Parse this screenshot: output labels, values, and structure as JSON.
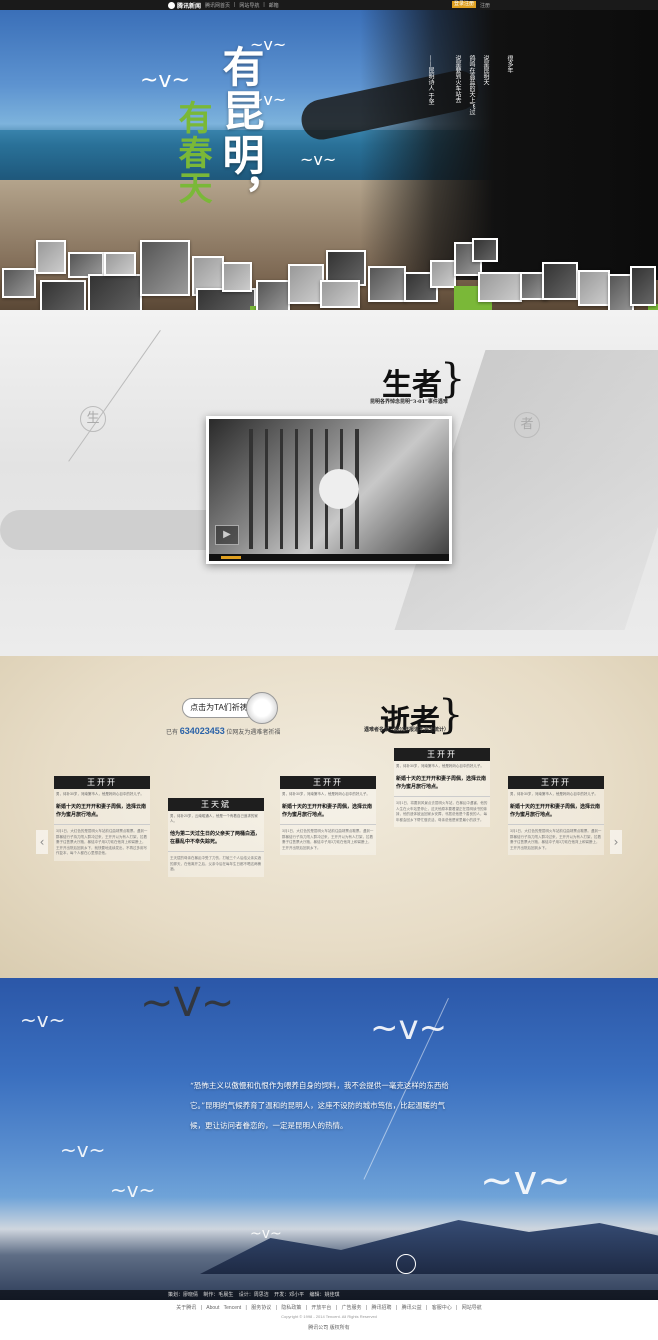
{
  "topbar": {
    "logo": "腾讯新闻",
    "nav": [
      "腾讯网首页",
      "|",
      "网站导航",
      "|",
      "邮箱"
    ],
    "login": "登录注册",
    "register": "注册"
  },
  "hero": {
    "title_main": "有昆明，",
    "title_sub": "有春天",
    "poem": [
      "说是要到火车站去",
      "说是昆明天",
      "鸽鸣在高蓝的天上飞过",
      "很多年"
    ],
    "poem_attr": "——昆明诗人 于坚"
  },
  "living": {
    "title": "生者",
    "subtitle": "昆明各界悼念昆明“3·01”事件遇难",
    "left_char": "生",
    "right_char": "者",
    "video": {
      "play_icon": "play-icon"
    }
  },
  "lost": {
    "title": "逝者",
    "subtitle": "遇难者名单（据公开报道不完全统计）",
    "pray_button": "点击为TA们祈祷",
    "count_prefix": "已有",
    "count_value": "634023453",
    "count_suffix": "位网友为遇难者祈福",
    "cards": [
      {
        "name": "王开开",
        "info": "男，待补30岁，河南第市人，他是妈妈心目中的好儿子。",
        "headline": "新婚十天的王开开和妻子周佩，选择云南作为蜜月旅行地点。",
        "body": "3月1日，大红色的是昆明火车站前往曲靖票点歇票。遇到一群暴徒行子持刀闯入群冲过来，王开开以为有人打架，拉着妻子往售票大厅跑，暴徒冲子用3刀砍在他背上和臂膀上，王开开出院后回到乡下，就快要地连续发出，不再过多用写作复本，每个人都在心里想念他。"
      },
      {
        "name": "王天斌",
        "info": "男，待补20岁，云南昭通人，他是一个有着自己追求的家人。",
        "headline": "他为第二天过生日的父亲买了两桶白酒，在暴乱中不幸失踪死。",
        "body": "王天斌的母亲在暴乱中受了刀伤，打破三个人后给父亲买酒的那天，在他离开之后，父亲今后在每年生日都不喝这两桶酒。"
      },
      {
        "name": "王开开",
        "info": "男，待补30岁，河南第市人，他是妈妈心目中的好儿子。",
        "headline": "新婚十天的王开开和妻子周佩，选择云南作为蜜月旅行地点。",
        "body": "3月1日，大红色的是昆明火车站前往曲靖票点歇票。遇到一群暴徒行子持刀闯入群冲过来，王开开以为有人打架，拉着妻子往售票大厅跑，暴徒冲子用3刀砍在他背上和臂膀上，王开开出院后回到乡下。"
      },
      {
        "name": "王开开",
        "info": "男，待补30岁，河南第市人，他是妈妈心目中的好儿子。",
        "headline": "新婚十天的王开开和妻子周佩，选择云南作为蜜月旅行地点。",
        "body": "3月1日，将要到风景点去昆明火车站，在暴乱中遇害，他的人生在火车站里停止，这天他原本要看望正在昆明读书的妹妹，他的遗体被运回家乡安葬，邻居说他是个善良的人，每年都会回乡下帮忙做农活，母亲说他是家里最小的孩子。"
      },
      {
        "name": "王开开",
        "info": "男，待补30岁，河南第市人，他是妈妈心目中的好儿子。",
        "headline": "新婚十天的王开开和妻子周佩，选择云南作为蜜月旅行地点。",
        "body": "3月1日，大红色的是昆明火车站前往曲靖票点歇票。遇到一群暴徒行子持刀闯入群冲过来，王开开以为有人打架，拉着妻子往售票大厅跑，暴徒冲子用3刀砍在他背上和臂膀上，王开开出院后回到乡下。"
      }
    ],
    "prev_arrow": "‹",
    "next_arrow": "›"
  },
  "quote": {
    "text": "“恐怖主义以傲慢和仇恨作为喂养自身的饲料，我不会提供一毫克这样的东西给它。”昆明的气候养育了温和的昆明人，这座不设防的城市笃信，比起温暖的气候，更让访问者眷恋的，一定是昆明人的热情。",
    "credits": "策划：廖晓倩 制作：毛晨生 设计：周思洁 开发：邓小平 编辑：姚佳琪"
  },
  "footer": {
    "links": "关于腾讯 | About Tencent | 服务协议 | 隐私政策 | 开放平台 | 广告服务 | 腾讯招聘 | 腾讯公益 | 客服中心 | 网站导航",
    "copyright": "Copyright © 1998 - 2014 Tencent. All Rights Reserved",
    "brand": "腾讯公司 版权所有"
  }
}
